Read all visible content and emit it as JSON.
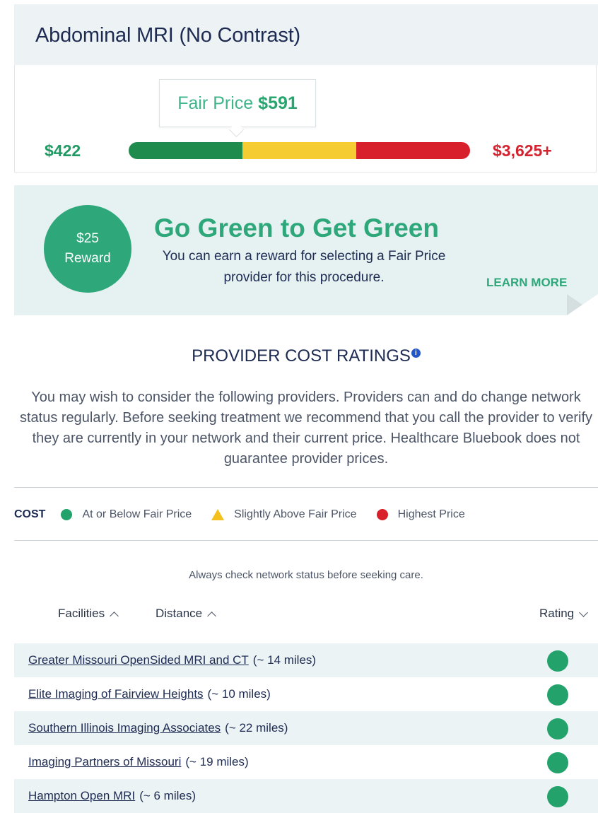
{
  "procedure": {
    "title": "Abdominal MRI (No Contrast)"
  },
  "price": {
    "fair_label": "Fair Price",
    "fair_value": "$591",
    "low": "$422",
    "high": "$3,625+",
    "colors": {
      "green": "#1f8c4d",
      "yellow": "#f5cd32",
      "red": "#d8202c"
    }
  },
  "reward": {
    "amount": "$25",
    "label": "Reward",
    "title": "Go Green to Get Green",
    "text": "You can earn a reward for selecting a Fair Price provider for this procedure.",
    "learn_more": "LEARN MORE"
  },
  "ratings": {
    "title": "PROVIDER COST RATINGS",
    "info_icon": "info-icon",
    "intro": "You may wish to consider the following providers. Providers can and do change network status regularly. Before seeking treatment we recommend that you call the provider to verify they are currently in your network and their current price. Healthcare Bluebook does not guarantee provider prices.",
    "legend": {
      "cost": "COST",
      "green": "At or Below Fair Price",
      "yellow": "Slightly Above Fair Price",
      "red": "Highest Price"
    },
    "note": "Always check network status before seeking care.",
    "sort": {
      "facilities": "Facilities",
      "distance": "Distance",
      "rating": "Rating"
    }
  },
  "providers": [
    {
      "name": "Greater Missouri OpenSided MRI and CT",
      "distance": "(~ 14 miles)",
      "rating": "green"
    },
    {
      "name": "Elite Imaging of Fairview Heights",
      "distance": "(~ 10 miles)",
      "rating": "green"
    },
    {
      "name": "Southern Illinois Imaging Associates",
      "distance": "(~ 22 miles)",
      "rating": "green"
    },
    {
      "name": "Imaging Partners of Missouri",
      "distance": "(~ 19 miles)",
      "rating": "green"
    },
    {
      "name": "Hampton Open MRI ",
      "distance": "(~ 6 miles)",
      "rating": "green"
    }
  ]
}
